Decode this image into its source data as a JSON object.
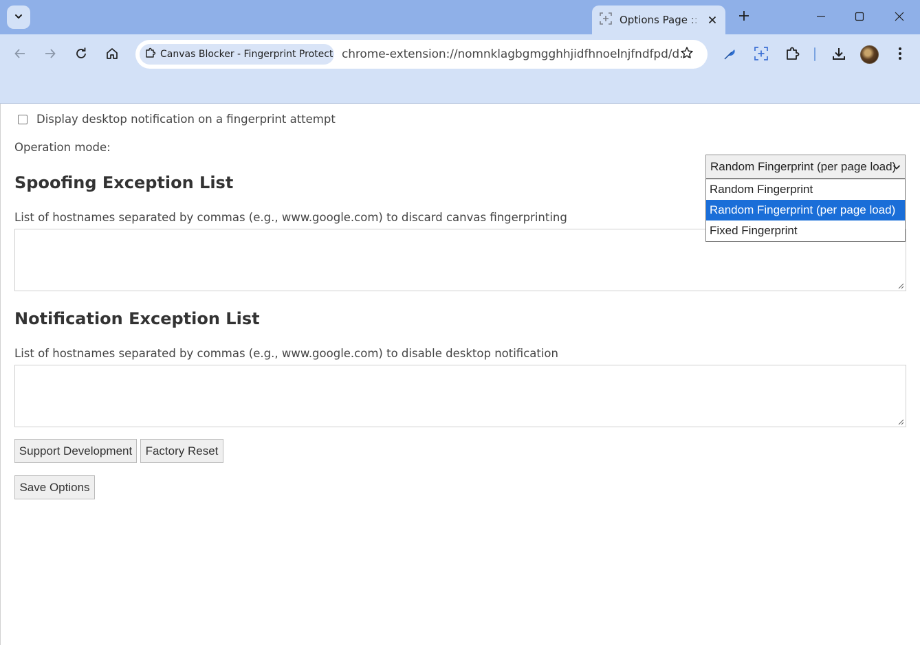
{
  "browser": {
    "tab": {
      "title": "Options Page :: Canvas Blocker - Fingerprint Protect"
    },
    "address_bar": {
      "site_chip": "Canvas Blocker - Fingerprint Protect",
      "url": "chrome-extension://nomnklagbgmgghhjidfhnoelnjfndfpd/d..."
    },
    "icons": {
      "tab_search": "chevron-down-icon",
      "tab_favicon": "capture-icon",
      "tab_close": "close-icon",
      "new_tab": "plus-icon",
      "minimize": "minimize-icon",
      "maximize": "maximize-icon",
      "close_window": "close-icon",
      "back": "arrow-left-icon",
      "forward": "arrow-right-icon",
      "reload": "reload-icon",
      "home": "home-icon",
      "bookmark": "star-icon",
      "extension_1": "feather-icon",
      "extension_2": "capture-icon",
      "extensions_menu": "puzzle-icon",
      "downloads": "download-icon",
      "profile": "avatar",
      "menu": "kebab-menu-icon"
    },
    "colors": {
      "titlebar": "#8fb0e8",
      "toolbar": "#d3e1f7",
      "selected_option": "#1a6ed8"
    }
  },
  "options": {
    "notification_checkbox": {
      "label": "Display desktop notification on a fingerprint attempt",
      "checked": false
    },
    "operation_mode": {
      "label": "Operation mode:",
      "selected": "Random Fingerprint (per page load)",
      "options": [
        "Random Fingerprint",
        "Random Fingerprint (per page load)",
        "Fixed Fingerprint"
      ],
      "selected_index": 1
    },
    "spoofing": {
      "heading": "Spoofing Exception List",
      "description": "List of hostnames separated by commas (e.g., www.google.com) to discard canvas fingerprinting",
      "value": ""
    },
    "notification_exceptions": {
      "heading": "Notification Exception List",
      "description": "List of hostnames separated by commas (e.g., www.google.com) to disable desktop notification",
      "value": ""
    },
    "buttons": {
      "support": "Support Development",
      "reset": "Factory Reset",
      "save": "Save Options"
    }
  }
}
